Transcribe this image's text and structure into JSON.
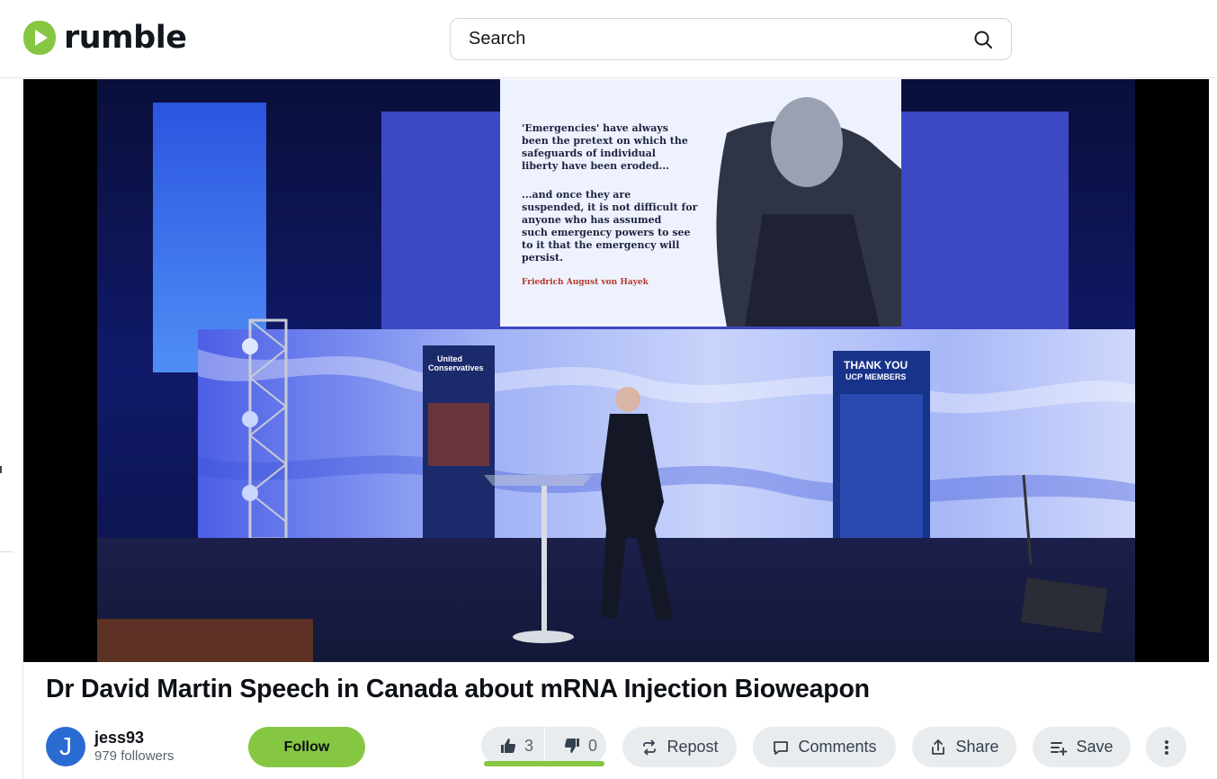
{
  "header": {
    "logo_text": "rumble",
    "search_placeholder": "Search"
  },
  "video": {
    "slide_quote_1": "'Emergencies' have always been the pretext on which the safeguards of individual liberty have been eroded...",
    "slide_quote_2": "...and once they are suspended, it is not difficult for anyone who has assumed such emergency powers to see to it that the emergency will persist.",
    "slide_author": "Friedrich August von Hayek",
    "banner_left_1": "United",
    "banner_left_2": "Conservatives",
    "banner_right_1": "THANK YOU",
    "banner_right_2": "UCP MEMBERS"
  },
  "title": "Dr David Martin Speech in Canada about mRNA Injection Bioweapon",
  "channel": {
    "avatar_letter": "J",
    "name": "jess93",
    "followers": "979 followers",
    "follow_label": "Follow"
  },
  "actions": {
    "likes": "3",
    "dislikes": "0",
    "repost": "Repost",
    "comments": "Comments",
    "share": "Share",
    "save": "Save"
  },
  "colors": {
    "brand_green": "#85c742",
    "pill_bg": "#e9ecef"
  }
}
